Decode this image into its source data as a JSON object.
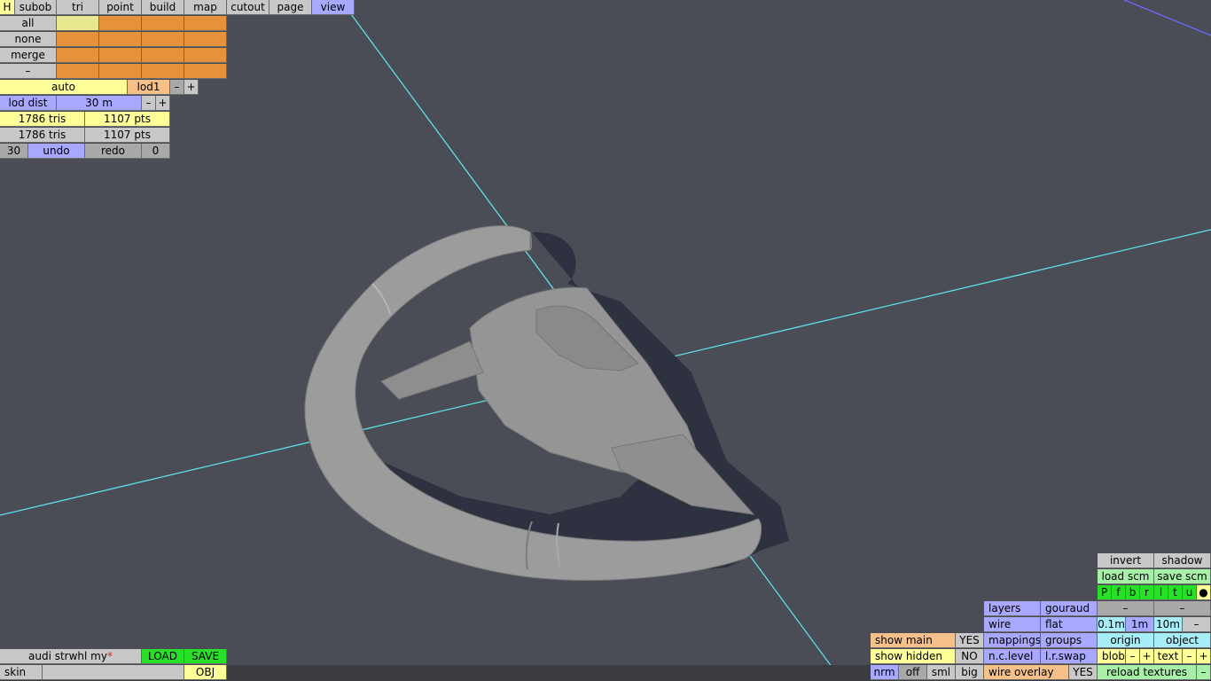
{
  "tabs": [
    "H",
    "subob",
    "tri",
    "point",
    "build",
    "map",
    "cutout",
    "page",
    "view"
  ],
  "select": {
    "all": "all",
    "none": "none",
    "merge": "merge",
    "minus": "–"
  },
  "lod": {
    "auto": "auto",
    "lod1": "lod1",
    "minus": "–",
    "plus": "+",
    "dist_label": "lod dist",
    "dist_value": "30 m",
    "dist_minus": "–",
    "dist_plus": "+"
  },
  "stats": {
    "tris1": "1786 tris",
    "pts1": "1107 pts",
    "tris2": "1786 tris",
    "pts2": "1107 pts"
  },
  "history": {
    "count": "30",
    "undo": "undo",
    "redo": "redo",
    "redo_count": "0"
  },
  "file": {
    "name": "audi strwhl my",
    "modified_mark": "*",
    "load": "LOAD",
    "save": "SAVE",
    "skin": "skin",
    "obj": "OBJ"
  },
  "right": {
    "invert": "invert",
    "shadow": "shadow",
    "load_scm": "load scm",
    "save_scm": "save scm",
    "views": [
      "P",
      "f",
      "b",
      "r",
      "l",
      "t",
      "u",
      "●"
    ],
    "layers": "layers",
    "gouraud": "gouraud",
    "minus1": "–",
    "minus2": "–",
    "wire": "wire",
    "flat": "flat",
    "g1": "0.1m",
    "g2": "1m",
    "g3": "10m",
    "gminus": "–",
    "show_main": "show main",
    "show_main_val": "YES",
    "mappings": "mappings",
    "groups": "groups",
    "origin": "origin",
    "object": "object",
    "show_hidden": "show hidden",
    "show_hidden_val": "NO",
    "nclevel": "n.c.level",
    "lrswap": "l.r.swap",
    "blob": "blob",
    "blob_minus": "–",
    "blob_plus": "+",
    "text": "text",
    "text_minus": "–",
    "text_plus": "+",
    "nrm": "nrm",
    "off": "off",
    "sml": "sml",
    "big": "big",
    "wire_overlay": "wire overlay",
    "wire_overlay_val": "YES",
    "reload": "reload textures",
    "reload_minus": "–"
  },
  "colors": {
    "background": "#4a4d56",
    "axis": "#5ee0e8",
    "mesh": "#9a9a9a",
    "shadow": "#2e3140"
  }
}
